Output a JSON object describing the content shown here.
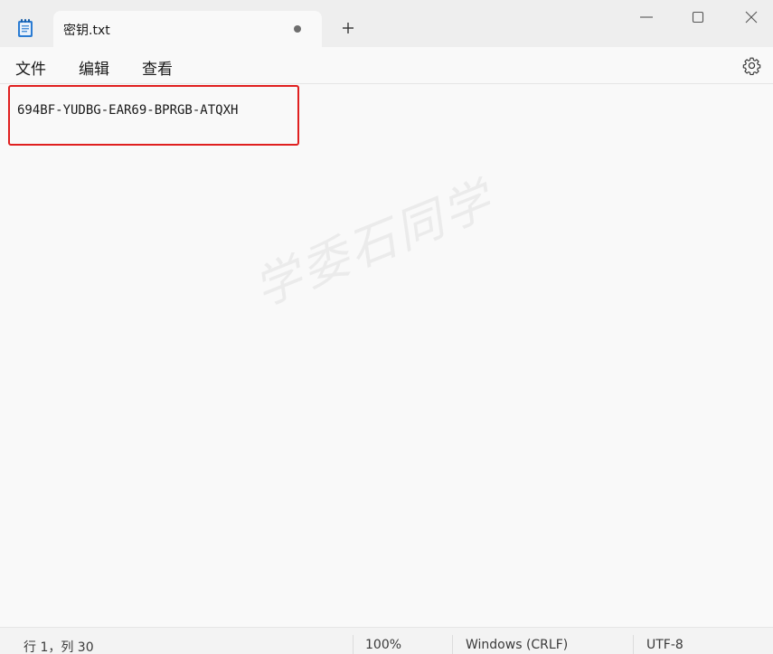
{
  "window": {
    "tab_title": "密钥.txt",
    "tab_modified": true,
    "app_icon": "notepad-icon"
  },
  "menu": {
    "file": "文件",
    "edit": "编辑",
    "view": "查看",
    "settings_icon": "gear-icon"
  },
  "editor": {
    "content": "694BF-YUDBG-EAR69-BPRGB-ATQXH",
    "highlight_color": "#e02020"
  },
  "watermark": {
    "text": "学委石同学"
  },
  "status": {
    "position": "行 1，列 30",
    "zoom": "100%",
    "line_ending": "Windows (CRLF)",
    "encoding": "UTF-8"
  }
}
